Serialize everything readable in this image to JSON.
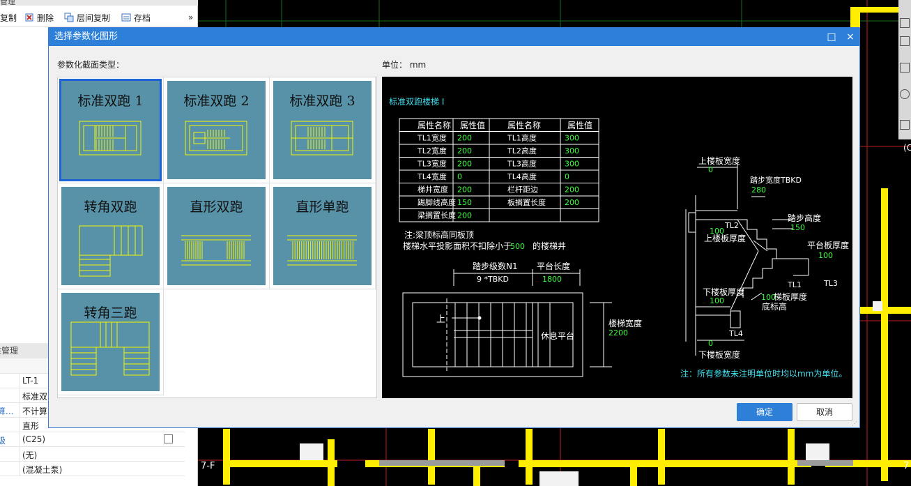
{
  "left_toolbar": {
    "copy_label": "复制",
    "delete_label": "删除",
    "floor_copy_label": "层间复制",
    "archive_label": "存档",
    "more": "»"
  },
  "left_header_top": "管理",
  "props_header": "属性管理",
  "props": [
    {
      "key": "",
      "value": "LT-1",
      "checkbox": false
    },
    {
      "key": "",
      "value": "标准双",
      "checkbox": false
    },
    {
      "key": "算...",
      "value": "不计算",
      "checkbox": false
    },
    {
      "key": "",
      "value": "直形",
      "checkbox": false
    },
    {
      "key": "级",
      "value": "(C25)",
      "checkbox": true
    },
    {
      "key": "",
      "value": "(无)",
      "checkbox": false
    },
    {
      "key": "",
      "value": "(混凝土泵)",
      "checkbox": false
    }
  ],
  "cad_labels": {
    "axis_left": "7-F",
    "axis_right": "7",
    "circle_label": "(C"
  },
  "dialog": {
    "title": "选择参数化图形",
    "max_icon": "□",
    "close_icon": "×",
    "section_label": "参数化截面类型：",
    "unit_label": "单位：  mm",
    "ok_label": "确定",
    "cancel_label": "取消"
  },
  "tiles": [
    {
      "label": "标准双跑 1",
      "selected": true
    },
    {
      "label": "标准双跑 2",
      "selected": false
    },
    {
      "label": "标准双跑 3",
      "selected": false
    },
    {
      "label": "转角双跑",
      "selected": false
    },
    {
      "label": "直形双跑",
      "selected": false
    },
    {
      "label": "直形单跑",
      "selected": false
    },
    {
      "label": "转角三跑",
      "selected": false
    }
  ],
  "preview": {
    "title": "标准双跑楼梯 I",
    "table_headers": [
      "属性名称",
      "属性值",
      "属性名称",
      "属性值"
    ],
    "table_rows": [
      [
        "TL1宽度",
        "200",
        "TL1高度",
        "300"
      ],
      [
        "TL2宽度",
        "200",
        "TL2高度",
        "300"
      ],
      [
        "TL3宽度",
        "200",
        "TL3高度",
        "300"
      ],
      [
        "TL4宽度",
        "0",
        "TL4高度",
        "0"
      ],
      [
        "梯井宽度",
        "200",
        "栏杆距边",
        "200"
      ],
      [
        "踢脚线高度",
        "150",
        "板搁置长度",
        "200"
      ],
      [
        "梁搁置长度",
        "200",
        "",
        ""
      ]
    ],
    "note1": "注:梁顶标高同板顶",
    "note2a": "楼梯水平投影面积不扣除小于",
    "note2b": "500",
    "note2c": "的楼梯井",
    "step_count_label": "踏步级数N1",
    "step_count_value": "9  *TBKD",
    "landing_len_label": "平台长度",
    "landing_len_value": "1800",
    "up_label": "上",
    "rest_label": "休息平台",
    "stair_width_label": "楼梯宽度",
    "stair_width_value": "2200",
    "top_slab_w_label": "上楼板宽度",
    "top_slab_w_value": "0",
    "tread_w_label": "踏步宽度TBKD",
    "tread_w_value": "280",
    "tread_h_label": "踏步高度",
    "tread_h_value": "150",
    "tl2": "TL2",
    "v100a": "100",
    "top_slab_t_label": "上楼板厚度",
    "landing_t_label": "平台板厚度",
    "landing_t_value": "100",
    "tl1": "TL1",
    "tl3": "TL3",
    "bot_slab_t_label": "下楼板厚度",
    "v100b": "100",
    "v100c": "100",
    "stair_t_label": "梯板厚度",
    "bottom_elev_label": "底标高",
    "tl4": "TL4",
    "bot_slab_w_value": "0",
    "bot_slab_w_label": "下楼板宽度",
    "footnote": "注：所有参数未注明单位时均以mm为单位。"
  }
}
